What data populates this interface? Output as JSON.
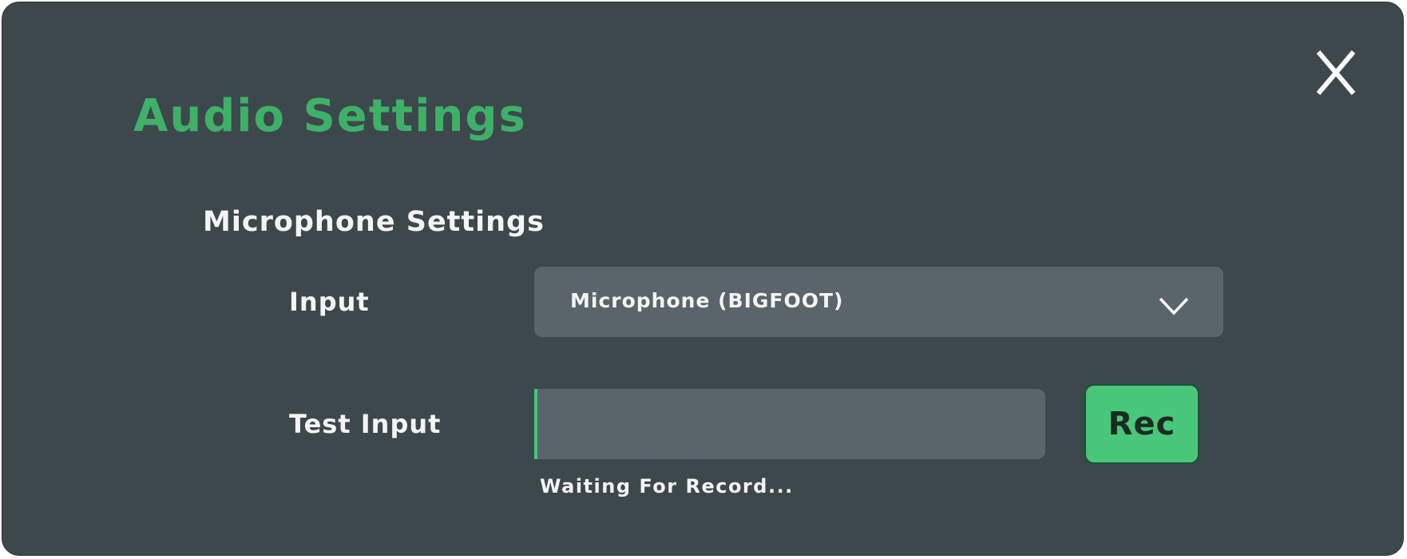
{
  "dialog": {
    "title": "Audio Settings",
    "close_icon": "close-x-icon"
  },
  "microphone": {
    "section_title": "Microphone Settings",
    "input_label": "Input",
    "input_selected": "Microphone (BIGFOOT)",
    "dropdown_icon": "chevron-down-icon",
    "test_label": "Test Input",
    "level_fraction": 0.005,
    "rec_label": "Rec",
    "status": "Waiting For Record..."
  },
  "colors": {
    "panel_bg": "#3d484d",
    "accent_green": "#3fb068",
    "button_green": "#48c679",
    "field_bg": "#5a656b",
    "text": "#f4f4f4"
  }
}
